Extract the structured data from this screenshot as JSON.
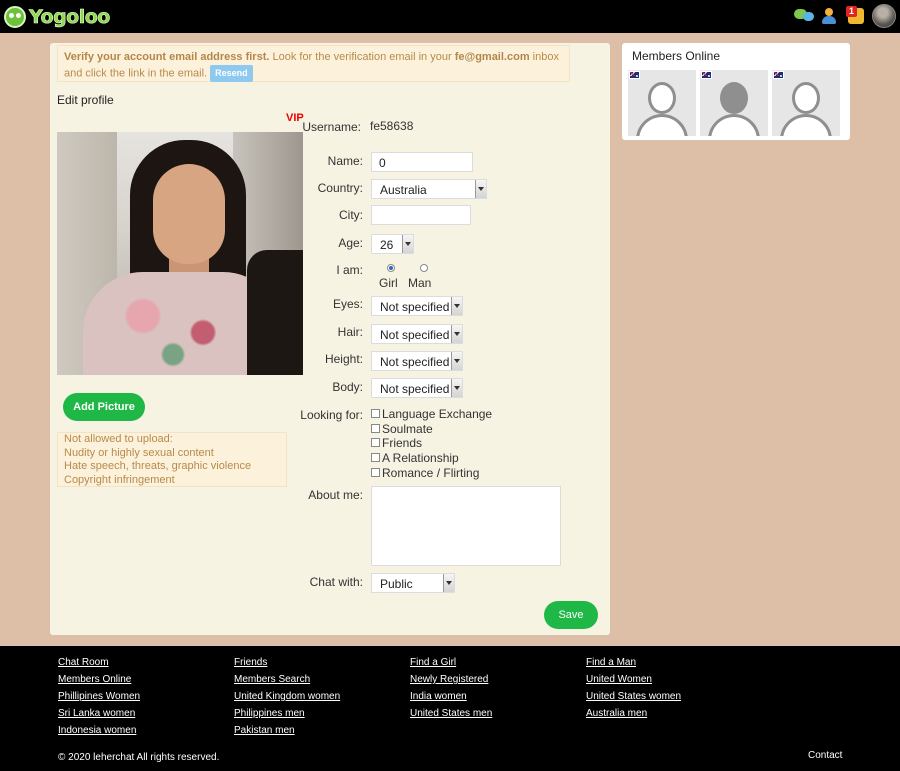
{
  "header": {
    "logo_text": "Yogoloo",
    "icons": [
      "chat-icon",
      "users-icon",
      "notifications-icon",
      "profile-avatar"
    ],
    "notification_count": "1"
  },
  "verify": {
    "bold": "Verify your account email address first.",
    "text1": " Look for the verification email in your ",
    "email": "fe@gmail.com",
    "text2": " inbox and click the link in the email.",
    "resend_label": "Resend"
  },
  "profile": {
    "title": "Edit profile",
    "vip": "VIP",
    "add_picture_label": "Add Picture",
    "rules": [
      "Not allowed to upload:",
      "Nudity or highly sexual content",
      "Hate speech, threats, graphic violence",
      "Copyright infringement"
    ]
  },
  "form": {
    "username_label": "Username:",
    "username_value": "fe58638",
    "name_label": "Name:",
    "name_value": "0",
    "country_label": "Country:",
    "country_value": "Australia",
    "city_label": "City:",
    "city_value": "",
    "age_label": "Age:",
    "age_value": "26",
    "iam_label": "I am:",
    "gender_girl": "Girl",
    "gender_man": "Man",
    "gender_selected": "Girl",
    "eyes_label": "Eyes:",
    "eyes_value": "Not specified",
    "hair_label": "Hair:",
    "hair_value": "Not specified",
    "height_label": "Height:",
    "height_value": "Not specified",
    "body_label": "Body:",
    "body_value": "Not specified",
    "looking_label": "Looking for:",
    "looking_options": [
      "Language Exchange",
      "Soulmate",
      "Friends",
      "A Relationship",
      "Romance / Flirting"
    ],
    "about_label": "About me:",
    "about_value": "",
    "chat_label": "Chat with:",
    "chat_value": "Public",
    "save_label": "Save"
  },
  "members": {
    "title": "Members Online",
    "cards": [
      "female-silhouette",
      "male-silhouette",
      "person-silhouette"
    ]
  },
  "footer": {
    "col1": [
      "Chat Room",
      "Members Online",
      "Phillipines Women",
      "Sri Lanka women",
      "Indonesia women"
    ],
    "col2": [
      "Friends",
      "Members Search",
      "United Kingdom women",
      "Philippines men",
      "Pakistan men"
    ],
    "col3": [
      "Find a Girl",
      "Newly Registered",
      "India women",
      "United States men"
    ],
    "col4": [
      "Find a Man",
      "United Women",
      "United States women",
      "Australia men"
    ],
    "copyright": "© 2020 leherchat All rights reserved.",
    "contact": "Contact"
  }
}
